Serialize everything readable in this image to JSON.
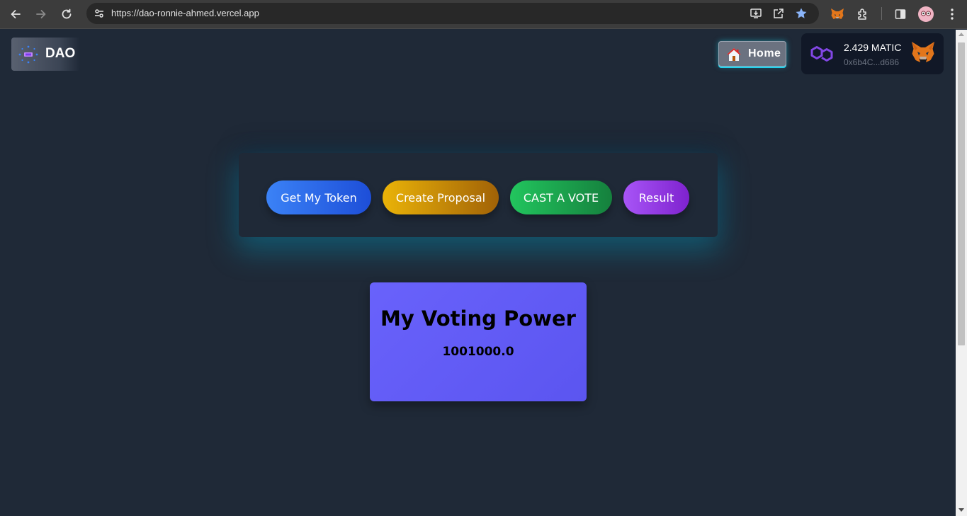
{
  "browser": {
    "url": "https://dao-ronnie-ahmed.vercel.app"
  },
  "header": {
    "logo_text": "DAO",
    "home_label": "Home"
  },
  "wallet": {
    "balance": "2.429 MATIC",
    "address": "0x6b4C...d686"
  },
  "actions": {
    "get_token": "Get My Token",
    "create_proposal": "Create Proposal",
    "cast_vote": "CAST A VOTE",
    "result": "Result"
  },
  "voting_power": {
    "title": "My Voting Power",
    "value": "1001000.0"
  },
  "colors": {
    "page_bg": "#1f2937",
    "token_button": "#3b82f6",
    "proposal_button": "#eab308",
    "vote_button": "#22c55e",
    "result_button": "#a855f7",
    "power_card": "#6962fb",
    "card_glow": "#0891b2"
  },
  "icons": [
    "back-arrow-icon",
    "forward-arrow-icon",
    "reload-icon",
    "site-settings-icon",
    "install-app-icon",
    "share-icon",
    "bookmark-star-icon",
    "metamask-extension-icon",
    "extensions-puzzle-icon",
    "side-panel-icon",
    "profile-avatar-icon",
    "more-menu-icon",
    "dao-logo-icon",
    "house-icon",
    "polygon-icon",
    "metamask-fox-icon"
  ]
}
